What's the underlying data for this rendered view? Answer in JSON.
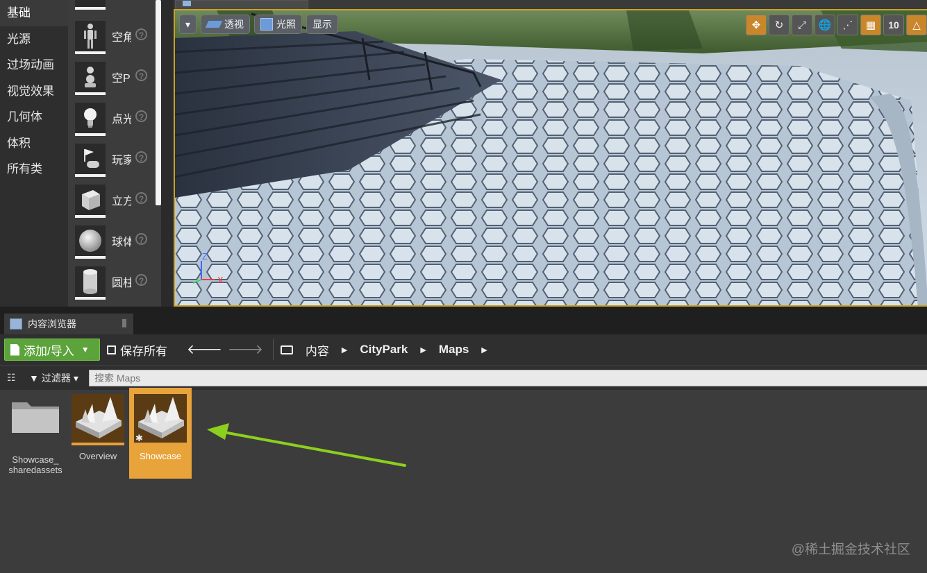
{
  "left_panel": {
    "categories": [
      "基础",
      "光源",
      "过场动画",
      "视觉效果",
      "几何体",
      "体积",
      "所有类"
    ],
    "active_category": "基础"
  },
  "place_actors": [
    {
      "label": "空角",
      "icon": "mannequin-icon"
    },
    {
      "label": "空P",
      "icon": "pawn-icon"
    },
    {
      "label": "点光",
      "icon": "lightbulb-icon"
    },
    {
      "label": "玩家",
      "icon": "player-start-icon"
    },
    {
      "label": "立方",
      "icon": "cube-icon"
    },
    {
      "label": "球体",
      "icon": "sphere-icon"
    },
    {
      "label": "圆柱",
      "icon": "cylinder-icon"
    }
  ],
  "viewport": {
    "menu_caret": "▾",
    "perspective_label": "透视",
    "lighting_label": "光照",
    "show_label": "显示",
    "grid_snap_value": "10",
    "axis_labels": {
      "z": "Z",
      "x": "X"
    }
  },
  "content_browser": {
    "tab_title": "内容浏览器",
    "add_import_label": "添加/导入",
    "save_all_label": "保存所有",
    "breadcrumbs": [
      "内容",
      "CityPark",
      "Maps"
    ],
    "filter_label": "过滤器",
    "search_placeholder": "搜索 Maps",
    "assets": [
      {
        "label": "Showcase_\nsharedassets",
        "type": "folder"
      },
      {
        "label": "Overview",
        "type": "map"
      },
      {
        "label": "Showcase",
        "type": "map",
        "selected": true
      }
    ]
  },
  "watermark": "@稀土掘金技术社区",
  "colors": {
    "accent_orange": "#e8a33a",
    "add_button_green": "#5ba33a",
    "annotation_arrow": "#8ccf1e"
  }
}
